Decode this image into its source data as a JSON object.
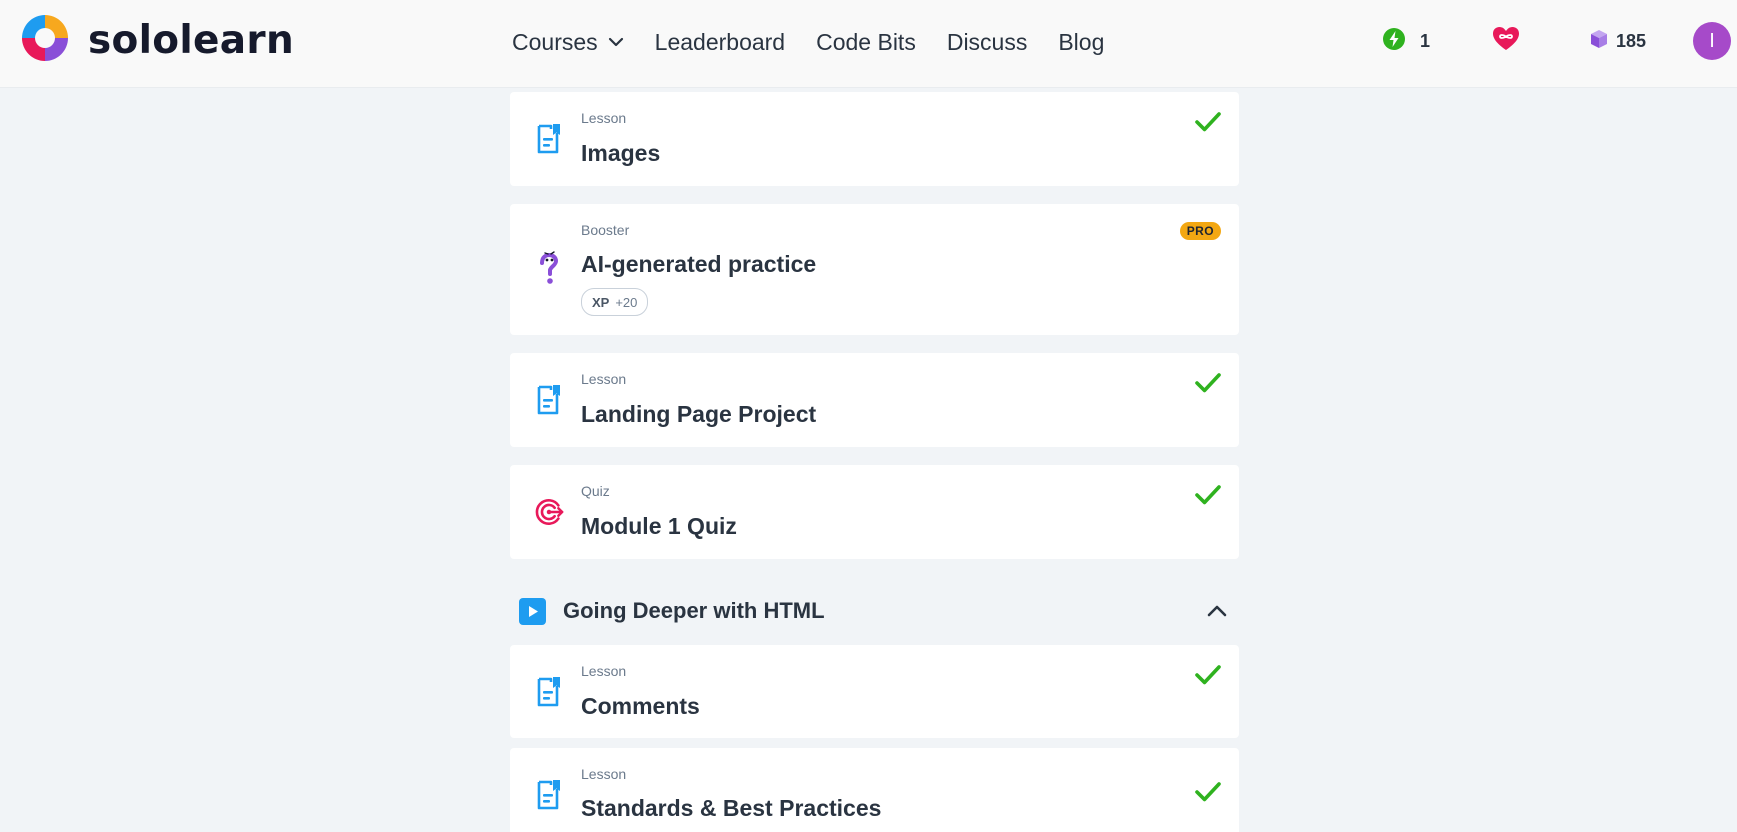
{
  "header": {
    "logo_text": "sololearn",
    "logo_icon": "sololearn-swirl-logo",
    "nav": {
      "courses": "Courses",
      "leaderboard": "Leaderboard",
      "code_bits": "Code Bits",
      "discuss": "Discuss",
      "blog": "Blog"
    },
    "streak": {
      "icon": "lightning-icon",
      "value": "1"
    },
    "hearts": {
      "icon": "heart-infinity-icon"
    },
    "bits": {
      "icon": "cube-icon",
      "value": "185"
    },
    "avatar_letter": "I"
  },
  "items": [
    {
      "type": "Lesson",
      "title": "Images",
      "icon": "lesson-document-icon",
      "completed": true
    },
    {
      "type": "Booster",
      "title": "AI-generated practice",
      "icon": "question-mark-icon",
      "badge": "PRO",
      "xp_label": "XP",
      "xp_value": "+20"
    },
    {
      "type": "Lesson",
      "title": "Landing Page Project",
      "icon": "lesson-document-icon",
      "completed": true
    },
    {
      "type": "Quiz",
      "title": "Module 1 Quiz",
      "icon": "target-icon",
      "completed": true
    },
    {
      "type": "Lesson",
      "title": "Comments",
      "icon": "lesson-document-icon",
      "completed": true
    },
    {
      "type": "Lesson",
      "title": "Standards & Best Practices",
      "icon": "lesson-document-icon",
      "completed": true
    }
  ],
  "module": {
    "title": "Going Deeper with HTML",
    "expanded": true
  },
  "colors": {
    "accent_blue": "#1e9cf0",
    "check_green": "#2fb21f",
    "pro_orange": "#f3a712",
    "quiz_pink": "#e8195a",
    "booster_purple": "#8a4fd8"
  }
}
